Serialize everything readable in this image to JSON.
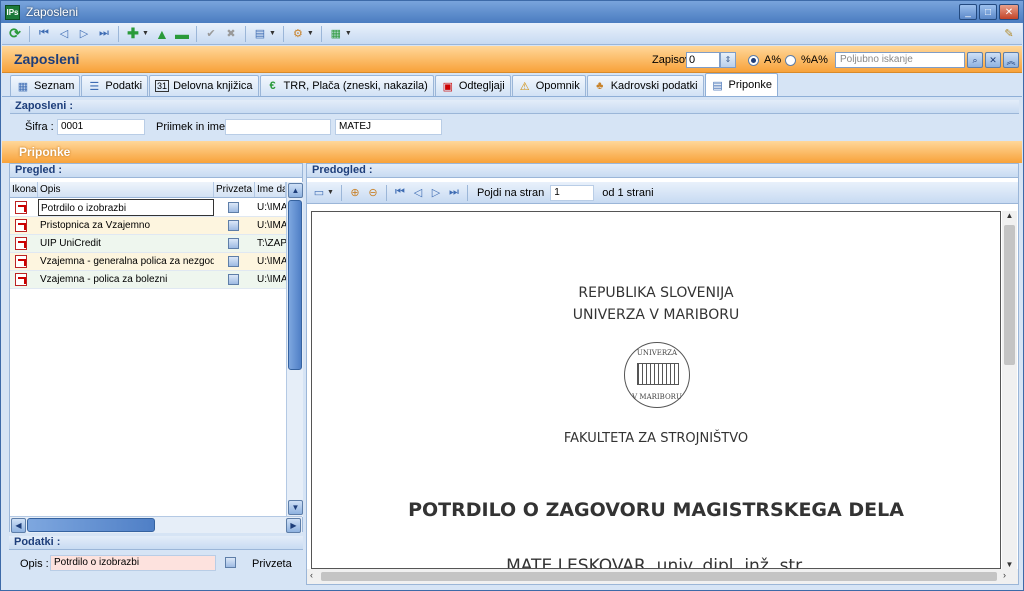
{
  "window": {
    "title": "Zaposleni",
    "app_icon": "IPs"
  },
  "header": {
    "title": "Zaposleni",
    "zapisov_label": "Zapisov :",
    "zapisov_value": "0",
    "radio1_label": "A%",
    "radio2_label": "%A%",
    "search_placeholder": "Poljubno iskanje"
  },
  "tabs": [
    {
      "label": "Seznam",
      "icon": "grid-icon"
    },
    {
      "label": "Podatki",
      "icon": "list-icon"
    },
    {
      "label": "Delovna knjižica",
      "icon": "calendar-icon",
      "glyph": "31"
    },
    {
      "label": "TRR, Plača (zneski, nakazila)",
      "icon": "euro-icon",
      "glyph": "€"
    },
    {
      "label": "Odtegljaji",
      "icon": "calc-icon"
    },
    {
      "label": "Opomnik",
      "icon": "warning-icon",
      "glyph": "⚠"
    },
    {
      "label": "Kadrovski podatki",
      "icon": "people-icon"
    },
    {
      "label": "Priponke",
      "icon": "attachment-icon"
    }
  ],
  "employee": {
    "section": "Zaposleni :",
    "sifra_label": "Šifra :",
    "sifra_value": "0001",
    "name_label": "Priimek in ime",
    "surname_value": "",
    "firstname_value": "MATEJ"
  },
  "priponke": {
    "title": "Priponke"
  },
  "pregled": {
    "title": "Pregled :",
    "columns": [
      "Ikona",
      "Opis",
      "Privzeta",
      "Ime da"
    ],
    "rows": [
      {
        "opis": "Potrdilo o izobrazbi",
        "path": "U:\\IMA"
      },
      {
        "opis": "Pristopnica za Vzajemno",
        "path": "U:\\IMA"
      },
      {
        "opis": "UIP UniCredit",
        "path": "T:\\ZAP"
      },
      {
        "opis": "Vzajemna - generalna polica za nezgode",
        "path": "U:\\IMA"
      },
      {
        "opis": "Vzajemna - polica za bolezni",
        "path": "U:\\IMA"
      }
    ]
  },
  "podatki": {
    "title": "Podatki :",
    "opis_label": "Opis :",
    "opis_value": "Potrdilo o izobrazbi",
    "privzeta_label": "Privzeta"
  },
  "predogled": {
    "title": "Predogled :",
    "goto_label": "Pojdi na stran",
    "page_value": "1",
    "of_label": "od 1 strani"
  },
  "document": {
    "line1": "REPUBLIKA SLOVENIJA",
    "line2": "UNIVERZA V MARIBORU",
    "seal_top": "UNIVERZA",
    "seal_bottom": "V MARIBORU",
    "faculty": "FAKULTETA ZA STROJNIŠTVO",
    "heading": "POTRDILO O ZAGOVORU MAGISTRSKEGA DELA",
    "partial": "MATE LESKOVAR, univ. dipl. inž. str."
  },
  "colors": {
    "orange": "#f8a23a",
    "blue": "#1e3e7a"
  }
}
